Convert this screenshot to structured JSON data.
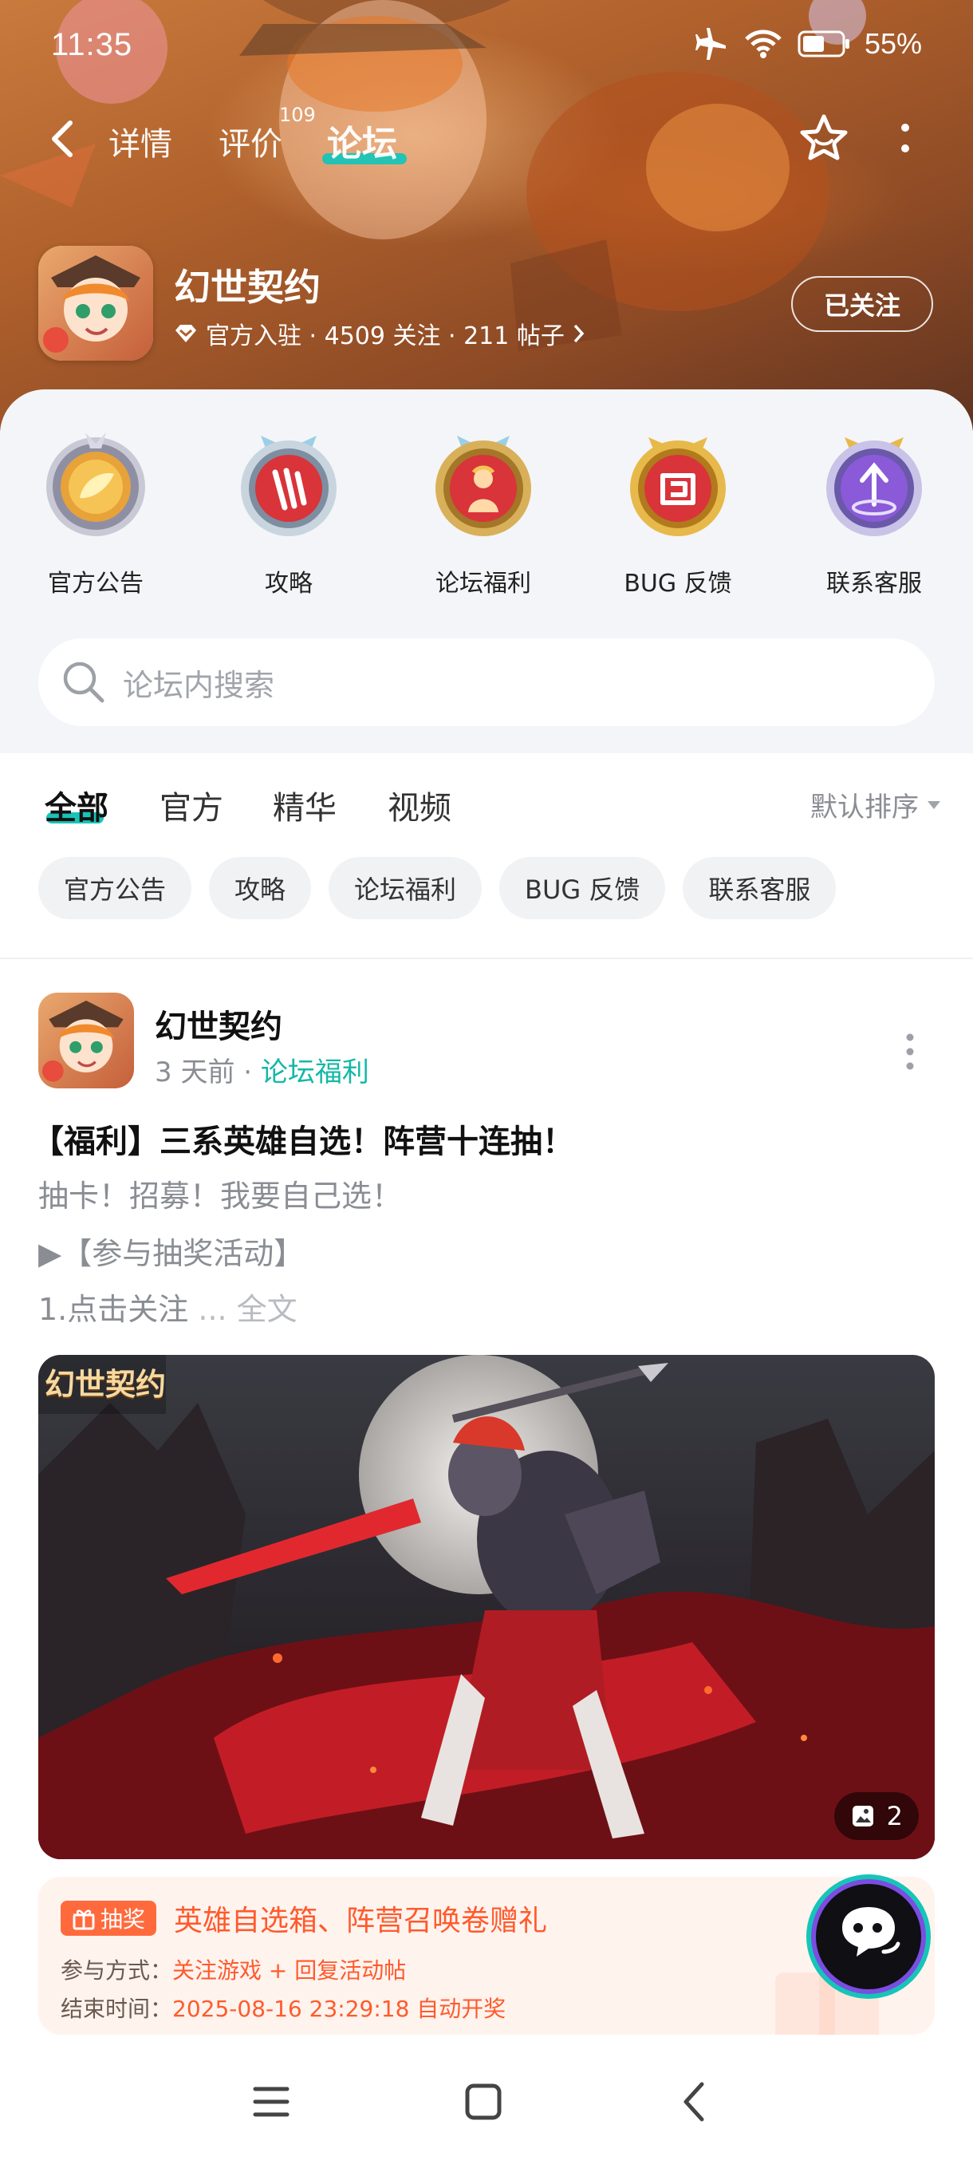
{
  "status_bar": {
    "time": "11:35",
    "battery_percent": "55%"
  },
  "top_nav": {
    "tabs": [
      "详情",
      "评价",
      "论坛"
    ],
    "active_tab": "论坛",
    "review_count_badge": "109"
  },
  "game": {
    "name": "幻世契约",
    "meta": "官方入驻 · 4509 关注 · 211 帖子",
    "follow_button": "已关注"
  },
  "categories": [
    {
      "label": "官方公告",
      "icon": "announcement-badge-icon",
      "color": "#e8a23a"
    },
    {
      "label": "攻略",
      "icon": "strategy-badge-icon",
      "color": "#d8343a"
    },
    {
      "label": "论坛福利",
      "icon": "welfare-badge-icon",
      "color": "#d8343a"
    },
    {
      "label": "BUG 反馈",
      "icon": "bug-feedback-badge-icon",
      "color": "#d8343a"
    },
    {
      "label": "联系客服",
      "icon": "customer-service-badge-icon",
      "color": "#8a5ad8"
    }
  ],
  "search": {
    "placeholder": "论坛内搜索"
  },
  "feed_tabs": [
    "全部",
    "官方",
    "精华",
    "视频"
  ],
  "sort_label": "默认排序",
  "chips": [
    "官方公告",
    "攻略",
    "论坛福利",
    "BUG 反馈",
    "联系客服"
  ],
  "post": {
    "author": "幻世契约",
    "time": "3 天前",
    "board": "论坛福利",
    "title": "【福利】三系英雄自选！阵营十连抽！",
    "lines": [
      "抽卡！招募！我要自己选！",
      "▶【参与抽奖活动】",
      "1.点击关注"
    ],
    "more_text": "... 全文",
    "image_count": "2",
    "image_logo_text": "幻世契约",
    "lottery": {
      "tag": "抽奖",
      "title": "英雄自选箱、阵营召唤卷赠礼",
      "method_label": "参与方式：",
      "method_value": "关注游戏 + 回复活动帖",
      "end_label": "结束时间：",
      "end_value": "2025-08-16 23:29:18 自动开奖"
    }
  },
  "colors": {
    "accent": "#18c4b8",
    "lottery": "#ff5a2c",
    "hero": "#b0612c"
  }
}
